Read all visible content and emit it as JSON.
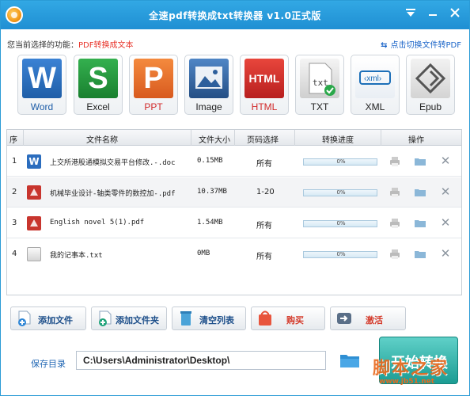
{
  "window": {
    "title": "全速pdf转换成txt转换器 v1.0正式版"
  },
  "function_bar": {
    "label": "您当前选择的功能：",
    "current": "PDF转换成文本",
    "switch_link": "点击切换文件转PDF"
  },
  "formats": [
    {
      "label": "Word",
      "icon": "word-icon",
      "color": "#2b6dbe"
    },
    {
      "label": "Excel",
      "icon": "excel-icon",
      "color": "#1f8f3c"
    },
    {
      "label": "PPT",
      "icon": "ppt-icon",
      "color": "#e56a2c"
    },
    {
      "label": "Image",
      "icon": "image-icon",
      "color": "#2d5f9c"
    },
    {
      "label": "HTML",
      "icon": "html-icon",
      "color": "#d12a2a"
    },
    {
      "label": "TXT",
      "icon": "txt-icon",
      "color": "#888888"
    },
    {
      "label": "XML",
      "icon": "xml-icon",
      "color": "#1c6fb8"
    },
    {
      "label": "Epub",
      "icon": "epub-icon",
      "color": "#555555"
    }
  ],
  "table": {
    "headers": [
      "序",
      "文件名称",
      "文件大小",
      "页码选择",
      "转换进度",
      "操作"
    ],
    "rows": [
      {
        "num": "1",
        "name": "上交所港股通模拟交易平台修改.-.doc",
        "size": "0.15MB",
        "pages": "所有",
        "progress": "0%",
        "type": "word",
        "progress_value": 0
      },
      {
        "num": "2",
        "name": "机械毕业设计-轴类零件的数控加-.pdf",
        "size": "10.37MB",
        "pages": "1-20",
        "progress": "0%",
        "type": "pdf",
        "progress_value": 0
      },
      {
        "num": "3",
        "name": "English novel 5(1).pdf",
        "size": "1.54MB",
        "pages": "所有",
        "progress": "0%",
        "type": "pdf",
        "progress_value": 0
      },
      {
        "num": "4",
        "name": "我的记事本.txt",
        "size": "0MB",
        "pages": "所有",
        "progress": "0%",
        "type": "txt",
        "progress_value": 0
      }
    ]
  },
  "actions": {
    "add_file": "添加文件",
    "add_folder": "添加文件夹",
    "clear_list": "清空列表",
    "buy": "购买",
    "activate": "激活"
  },
  "save": {
    "label": "保存目录",
    "path": "C:\\Users\\Administrator\\Desktop\\",
    "start": "开始转换"
  },
  "watermark": {
    "text": "脚本之家",
    "site": "www.jb51.net"
  }
}
